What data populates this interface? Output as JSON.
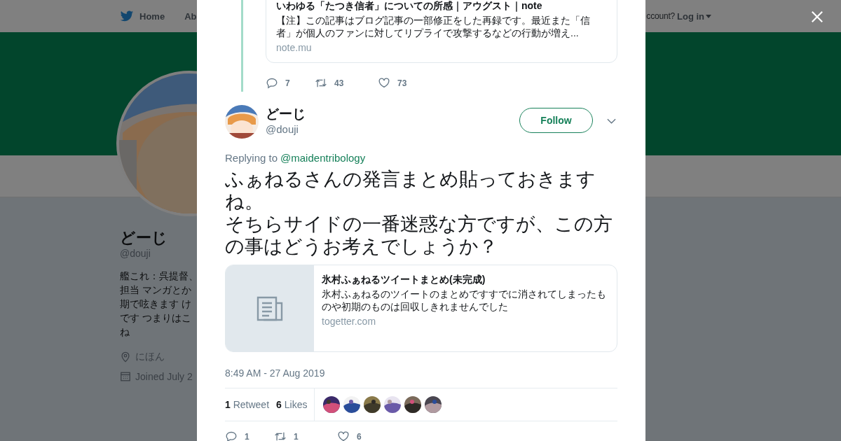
{
  "background": {
    "nav": {
      "home": "Home",
      "about": "Ab",
      "login_prompt": "ccount?",
      "login": "Log in"
    },
    "profile": {
      "name": "どーじ",
      "handle": "@douji",
      "bio_lines": [
        "艦これ：呉提督、",
        "担当 マンガとか",
        "期で呟きます け",
        "です つまりはこ",
        "ね"
      ],
      "location": "にほん",
      "joined": "Joined July 2"
    }
  },
  "previous_tweet": {
    "card": {
      "title": "いわゆる「たつき信者」についての所感｜アウグスト｜note",
      "description": "【注】この記事はブログ記事の一部修正をした再録です。最近また「信者」が個人のファンに対してリプライで攻撃するなどの行動が増え...",
      "domain": "note.mu"
    },
    "actions": {
      "replies": "7",
      "retweets": "43",
      "likes": "73"
    }
  },
  "tweet": {
    "name": "どーじ",
    "handle": "@douji",
    "follow": "Follow",
    "replying_label": "Replying to",
    "replying_to": "@maidentribology",
    "text_lines": [
      "ふぁねるさんの発言まとめ貼っておきますね。",
      "そちらサイドの一番迷惑な方ですが、この方の事はどうお考えでしょうか？"
    ],
    "card": {
      "title": "氷村ふぁねるツイートまとめ(未完成)",
      "description": "氷村ふぁねるのツイートのまとめですすでに消されてしまったものや初期のものは回収しきれませんでした",
      "domain": "togetter.com"
    },
    "timestamp": "8:49 AM - 27 Aug 2019",
    "stats": [
      "**1** Retweet",
      "**6** Likes"
    ],
    "actions": {
      "replies": "1",
      "retweets": "1",
      "likes": "6"
    }
  }
}
